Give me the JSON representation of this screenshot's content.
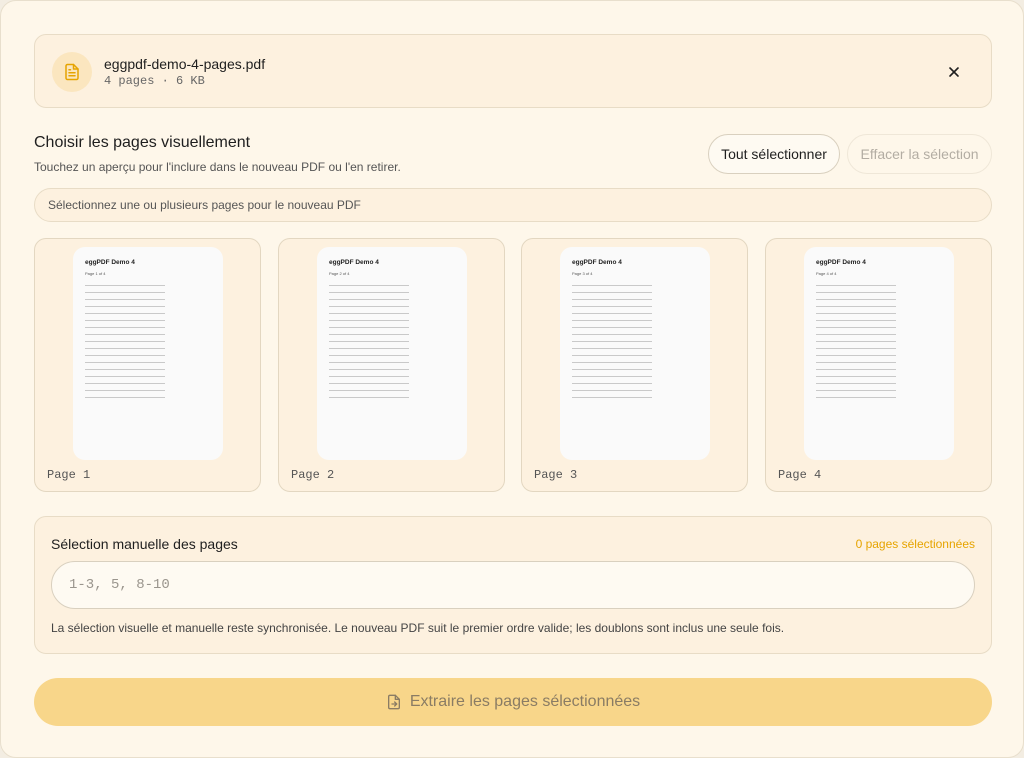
{
  "file": {
    "name": "eggpdf-demo-4-pages.pdf",
    "meta": "4 pages · 6 KB"
  },
  "visual": {
    "title": "Choisir les pages visuellement",
    "subtitle": "Touchez un aperçu pour l'inclure dans le nouveau PDF ou l'en retirer.",
    "select_all_label": "Tout sélectionner",
    "clear_label": "Effacer la sélection",
    "hint": "Sélectionnez une ou plusieurs pages pour le nouveau PDF"
  },
  "pages": [
    {
      "label": "Page 1",
      "doc_title": "eggPDF Demo 4",
      "doc_sub": "Page 1 of 4",
      "selected": false
    },
    {
      "label": "Page 2",
      "doc_title": "eggPDF Demo 4",
      "doc_sub": "Page 2 of 4",
      "selected": false
    },
    {
      "label": "Page 3",
      "doc_title": "eggPDF Demo 4",
      "doc_sub": "Page 3 of 4",
      "selected": false
    },
    {
      "label": "Page 4",
      "doc_title": "eggPDF Demo 4",
      "doc_sub": "Page 4 of 4",
      "selected": false
    }
  ],
  "manual": {
    "title": "Sélection manuelle des pages",
    "count": "0 pages sélectionnées",
    "value": "",
    "placeholder": "1-3, 5, 8-10",
    "note": "La sélection visuelle et manuelle reste synchronisée. Le nouveau PDF suit le premier ordre valide; les doublons sont inclus une seule fois."
  },
  "extract": {
    "label": "Extraire les pages sélectionnées",
    "enabled": false
  },
  "icons": {
    "file": "file-text-icon",
    "close": "close-icon",
    "extract": "file-export-icon"
  },
  "colors": {
    "accent": "#e6a400",
    "extract_disabled_bg": "#f8d68a",
    "background": "#fef7ea"
  }
}
